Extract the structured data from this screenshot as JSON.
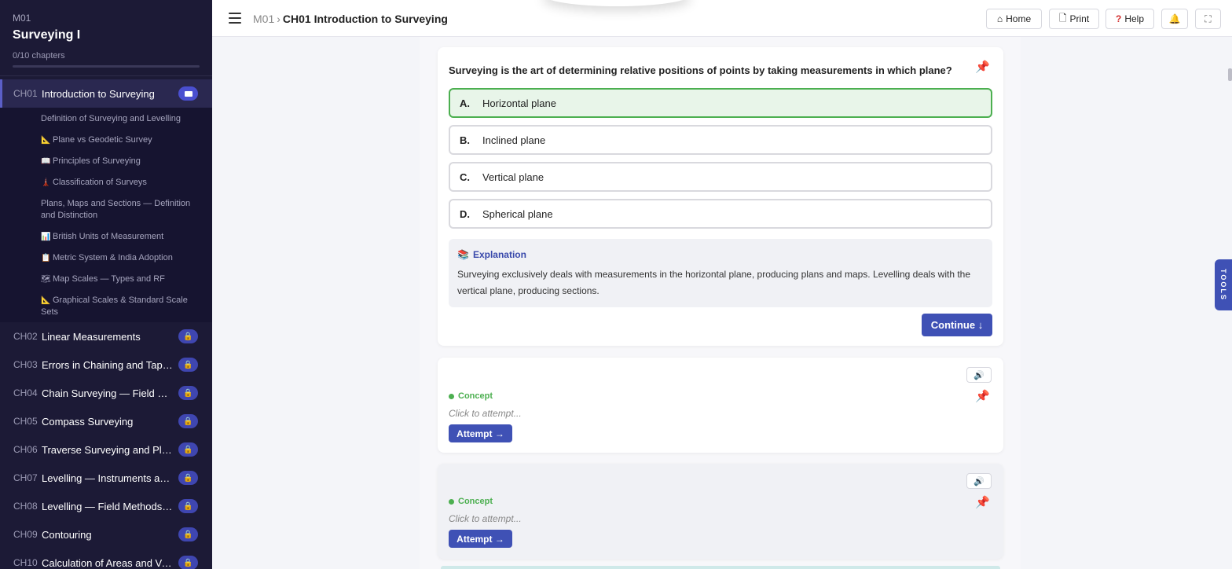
{
  "sidebar": {
    "module": "M01",
    "course": "Surveying I",
    "progress": "0/10 chapters",
    "chapters": [
      {
        "code": "CH01",
        "title": "Introduction to Surveying"
      },
      {
        "code": "CH02",
        "title": "Linear Measurements"
      },
      {
        "code": "CH03",
        "title": "Errors in Chaining and Tape C..."
      },
      {
        "code": "CH04",
        "title": "Chain Surveying — Field Met..."
      },
      {
        "code": "CH05",
        "title": "Compass Surveying"
      },
      {
        "code": "CH06",
        "title": "Traverse Surveying and Plane ..."
      },
      {
        "code": "CH07",
        "title": "Levelling — Instruments and ..."
      },
      {
        "code": "CH08",
        "title": "Levelling — Field Methods an..."
      },
      {
        "code": "CH09",
        "title": "Contouring"
      },
      {
        "code": "CH10",
        "title": "Calculation of Areas and Volu..."
      }
    ],
    "subtopics": [
      {
        "icon": "",
        "label": "Definition of Surveying and Levelling"
      },
      {
        "icon": "📐",
        "label": "Plane vs Geodetic Survey"
      },
      {
        "icon": "📖",
        "label": "Principles of Surveying"
      },
      {
        "icon": "🗼",
        "label": "Classification of Surveys"
      },
      {
        "icon": "",
        "label": "Plans, Maps and Sections — Definition and Distinction"
      },
      {
        "icon": "📊",
        "label": "British Units of Measurement"
      },
      {
        "icon": "📋",
        "label": "Metric System & India Adoption"
      },
      {
        "icon": "🗺",
        "label": "Map Scales — Types and RF"
      },
      {
        "icon": "📐",
        "label": "Graphical Scales & Standard Scale Sets"
      }
    ]
  },
  "topbar": {
    "breadcrumb_module": "M01",
    "breadcrumb_separator": "›",
    "breadcrumb_current": "CH01 Introduction to Surveying",
    "home_label": "Home",
    "print_label": "Print",
    "help_label": "Help"
  },
  "question": {
    "text": "Surveying is the art of determining relative positions of points by taking measurements in which plane?",
    "options": [
      {
        "key": "A.",
        "label": "Horizontal plane"
      },
      {
        "key": "B.",
        "label": "Inclined plane"
      },
      {
        "key": "C.",
        "label": "Vertical plane"
      },
      {
        "key": "D.",
        "label": "Spherical plane"
      }
    ],
    "explanation_title": "Explanation",
    "explanation_body": "Surveying exclusively deals with measurements in the horizontal plane, producing plans and maps. Levelling deals with the vertical plane, producing sections.",
    "continue_label": "Continue ↓"
  },
  "concept_cards": [
    {
      "tag": "Concept",
      "hint": "Click to attempt...",
      "button": "Attempt →"
    },
    {
      "tag": "Concept",
      "hint": "Click to attempt...",
      "button": "Attempt →"
    }
  ],
  "tools_label": "TOOLS",
  "colors": {
    "sidebar_bg": "#1c1a36",
    "accent": "#3f51b5",
    "correct": "#4caf50",
    "lock_badge": "#3f46b0"
  }
}
